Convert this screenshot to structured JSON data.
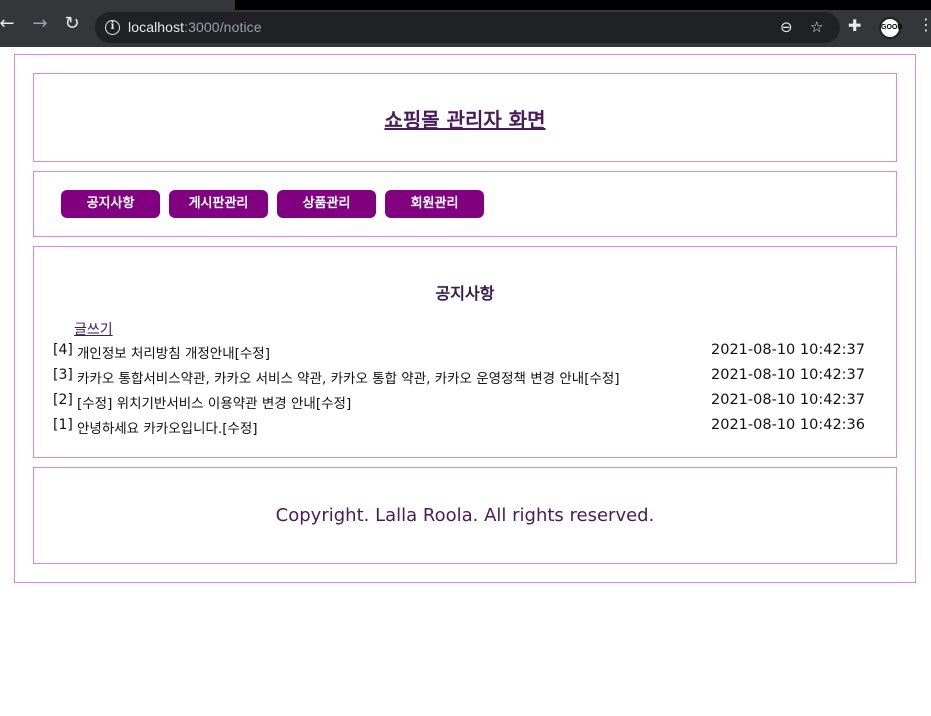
{
  "browser": {
    "url_host": "localhost",
    "url_path": ":3000/notice",
    "profile_label": "GOOD",
    "icons": [
      "back-icon",
      "forward-icon",
      "reload-icon",
      "info-icon",
      "zoom-icon",
      "star-icon",
      "extensions-icon",
      "menu-icon"
    ]
  },
  "header": {
    "title": "쇼핑몰 관리자 화면"
  },
  "nav": {
    "items": [
      {
        "label": "공지사항"
      },
      {
        "label": "게시판관리"
      },
      {
        "label": "상품관리"
      },
      {
        "label": "회원관리"
      }
    ]
  },
  "notice": {
    "heading": "공지사항",
    "write_label": "글쓰기",
    "rows": [
      {
        "num": "[4]",
        "title": "개인정보 처리방침 개정안내[수정]",
        "date": "2021-08-10 10:42:37"
      },
      {
        "num": "[3]",
        "title": "카카오 통합서비스약관, 카카오 서비스 약관, 카카오 통합 약관, 카카오 운영정책 변경 안내[수정]",
        "date": "2021-08-10 10:42:37"
      },
      {
        "num": "[2]",
        "title": "[수정] 위치기반서비스 이용약관 변경 안내[수정]",
        "date": "2021-08-10 10:42:37"
      },
      {
        "num": "[1]",
        "title": "안녕하세요 카카오입니다.[수정]",
        "date": "2021-08-10 10:42:36"
      }
    ]
  },
  "footer": {
    "copyright": "Copyright. Lalla Roola. All rights reserved."
  },
  "colors": {
    "accent": "#800080",
    "border": "#dd88dd",
    "title_text": "#4a1a5a"
  }
}
